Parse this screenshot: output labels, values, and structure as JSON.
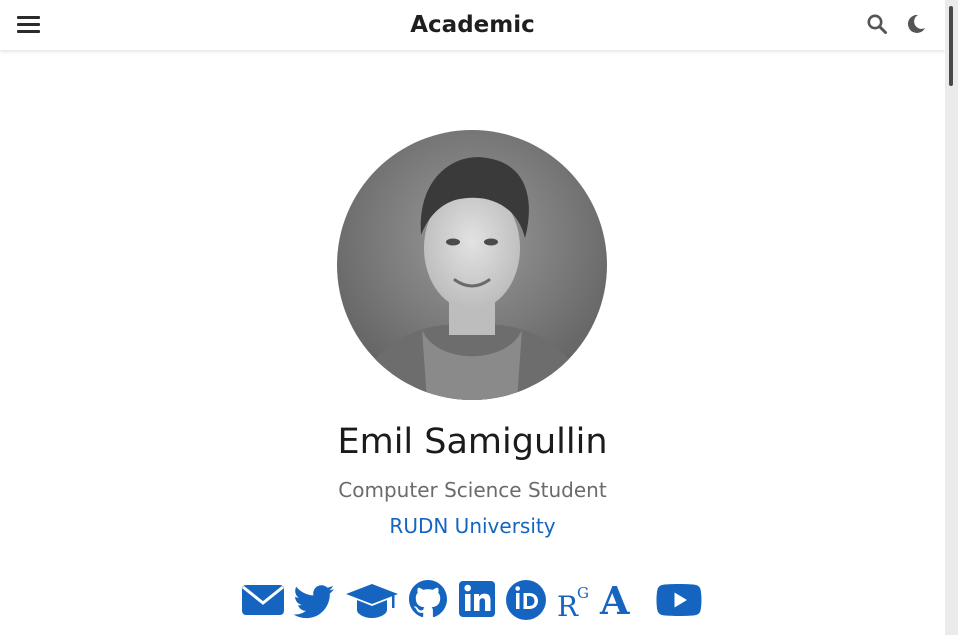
{
  "navbar": {
    "brand": "Academic",
    "menu_icon": "hamburger-menu-icon",
    "search_icon": "search-icon",
    "theme_icon": "moon-icon"
  },
  "profile": {
    "name": "Emil Samigullin",
    "role": "Computer Science Student",
    "organization": "RUDN University",
    "avatar_icon": "profile-photo"
  },
  "social": [
    {
      "icon": "envelope-icon"
    },
    {
      "icon": "twitter-icon"
    },
    {
      "icon": "graduation-cap-icon"
    },
    {
      "icon": "github-icon"
    },
    {
      "icon": "linkedin-icon"
    },
    {
      "icon": "orcid-icon"
    },
    {
      "icon": "researchgate-icon",
      "text": "R",
      "superscript": "G"
    },
    {
      "icon": "academia-icon",
      "text": "A"
    },
    {
      "icon": "youtube-icon"
    }
  ],
  "colors": {
    "accent": "#1565c0",
    "icon": "#1565c0",
    "text": "#1b1b1b",
    "muted": "#6b6b6b"
  }
}
